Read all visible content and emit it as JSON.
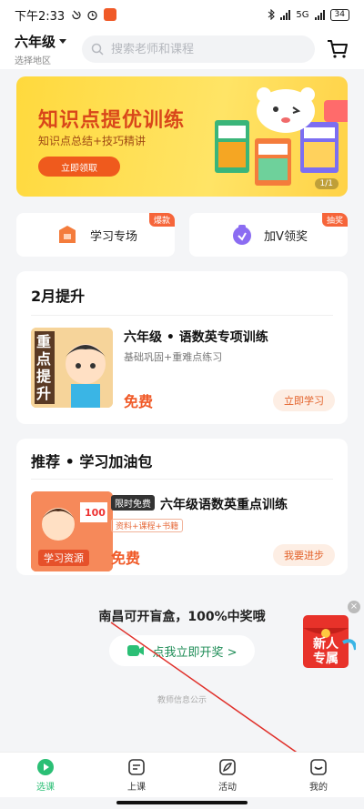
{
  "status_bar": {
    "time": "下午2:33",
    "network": "5G",
    "battery": "34"
  },
  "header": {
    "grade": "六年级",
    "region": "选择地区"
  },
  "search": {
    "placeholder": "搜索老师和课程"
  },
  "banner": {
    "title": "知识点提优训练",
    "subtitle": "知识点总结+技巧精讲",
    "button": "立即领取",
    "page_indicator": "1/1"
  },
  "quick_entries": [
    {
      "label": "学习专场",
      "tag": "爆款"
    },
    {
      "label": "加V领奖",
      "tag": "抽奖"
    }
  ],
  "card1": {
    "title": "2月提升",
    "course_name": "六年级 • 语数英专项训练",
    "course_desc": "基础巩固+重难点练习",
    "price": "免费",
    "button": "立即学习",
    "thumb_text": [
      "重",
      "点",
      "提",
      "升"
    ]
  },
  "card2": {
    "title": "推荐 • 学习加油包",
    "free_tag": "限时免费",
    "course_name": "六年级语数英重点训练",
    "info_tag": "资料+课程+书籍",
    "price": "免费",
    "button": "我要进步",
    "thumb_label": "学习资源",
    "thumb_score": "100"
  },
  "promo": {
    "title": "南昌可开盲盒，100%中奖哦",
    "button": "点我立即开奖 >",
    "notice": "教师信息公示",
    "newbie_line1": "新人",
    "newbie_line2": "专属"
  },
  "tabbar": [
    {
      "label": "选课",
      "icon": "play-circle-icon",
      "active": true
    },
    {
      "label": "上课",
      "icon": "class-icon",
      "active": false
    },
    {
      "label": "活动",
      "icon": "leaf-icon",
      "active": false
    },
    {
      "label": "我的",
      "icon": "profile-icon",
      "active": false
    }
  ],
  "colors": {
    "brand_green": "#2bbf75",
    "accent_orange": "#f05a28",
    "banner_yellow": "#ffd93d",
    "annotation_red": "#e0302a"
  }
}
